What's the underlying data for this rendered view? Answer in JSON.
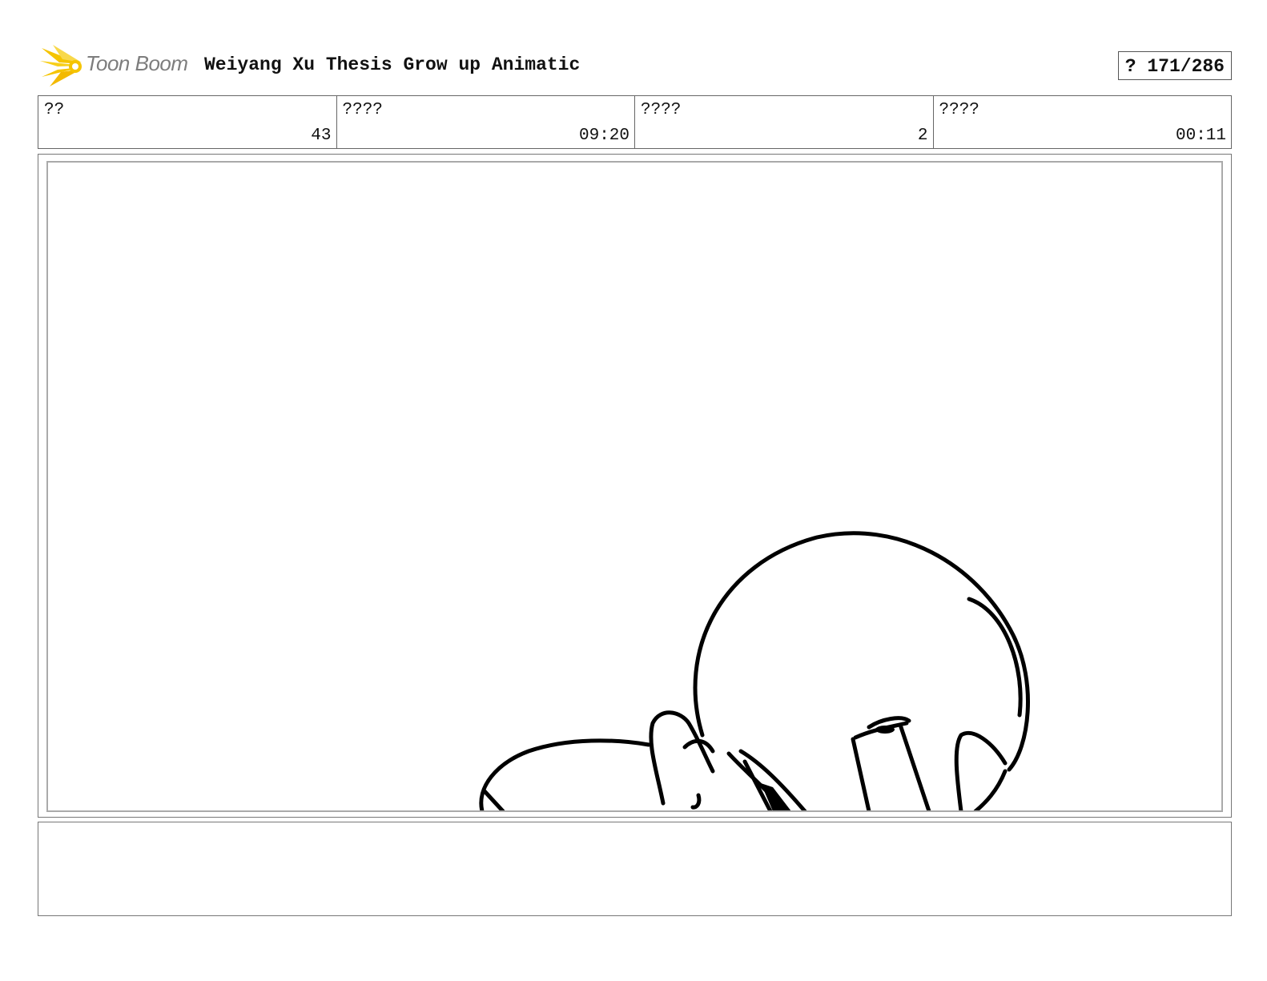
{
  "header": {
    "brand": "Toon Boom",
    "title": "Weiyang Xu Thesis Grow up Animatic",
    "page_indicator": "? 171/286"
  },
  "info": [
    {
      "label": "??",
      "value": "43"
    },
    {
      "label": "????",
      "value": "09:20"
    },
    {
      "label": "????",
      "value": "2"
    },
    {
      "label": "????",
      "value": "00:11"
    }
  ],
  "panel": {
    "drawing": "sketch-character-hands-over-head"
  },
  "notes": {
    "text": ""
  },
  "colors": {
    "logo_yellow": "#f5c400",
    "logo_text": "#7d7d7d",
    "line": "#000000"
  }
}
